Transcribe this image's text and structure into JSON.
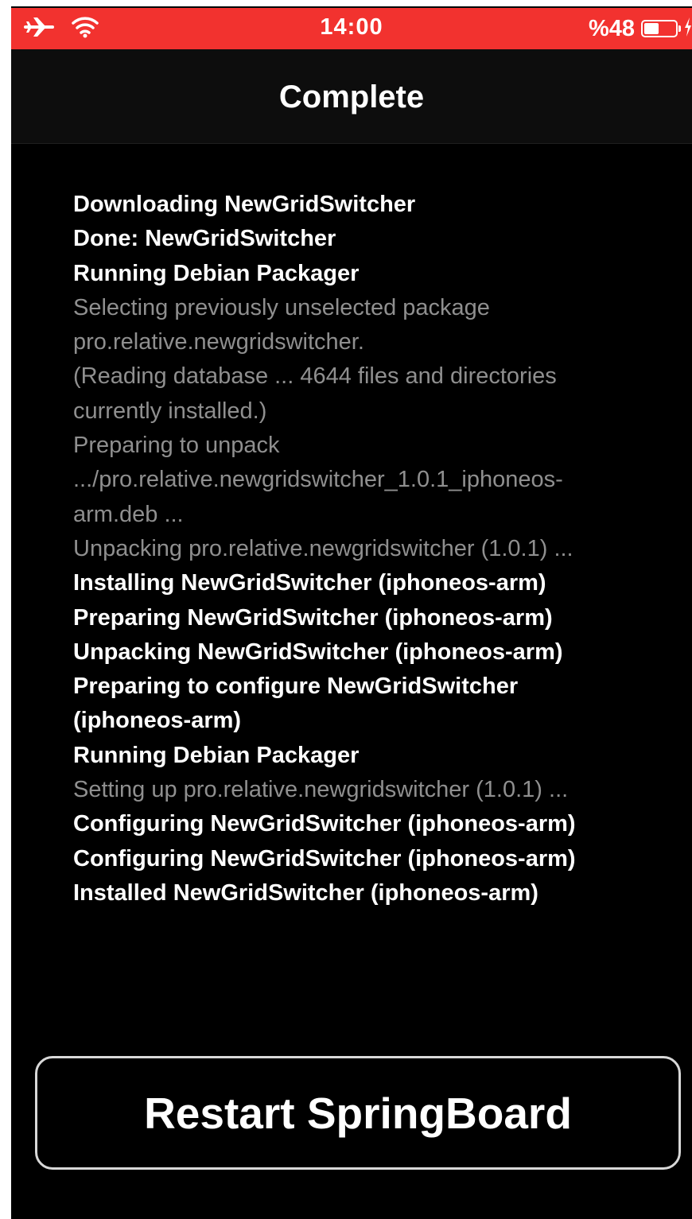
{
  "status_bar": {
    "time": "14:00",
    "battery_percent": "%48",
    "battery_level": 0.48,
    "background_color": "#f2322f",
    "icons": [
      "airplane-icon",
      "wifi-icon",
      "battery-icon",
      "charging-bolt-icon"
    ]
  },
  "nav": {
    "title": "Complete"
  },
  "log": {
    "lines": [
      {
        "text": "Downloading NewGridSwitcher",
        "style": "strong"
      },
      {
        "text": "Done: NewGridSwitcher",
        "style": "strong"
      },
      {
        "text": "Running Debian Packager",
        "style": "strong"
      },
      {
        "text": "Selecting previously unselected package",
        "style": "dim"
      },
      {
        "text": "pro.relative.newgridswitcher.",
        "style": "dim"
      },
      {
        "text": "(Reading database ... 4644 files and directories",
        "style": "dim"
      },
      {
        "text": "currently installed.)",
        "style": "dim"
      },
      {
        "text": "Preparing to unpack",
        "style": "dim"
      },
      {
        "text": ".../pro.relative.newgridswitcher_1.0.1_iphoneos-",
        "style": "dim"
      },
      {
        "text": "arm.deb ...",
        "style": "dim"
      },
      {
        "text": "Unpacking pro.relative.newgridswitcher (1.0.1) ...",
        "style": "dim"
      },
      {
        "text": "Installing NewGridSwitcher (iphoneos-arm)",
        "style": "strong"
      },
      {
        "text": "Preparing NewGridSwitcher (iphoneos-arm)",
        "style": "strong"
      },
      {
        "text": "Unpacking NewGridSwitcher (iphoneos-arm)",
        "style": "strong"
      },
      {
        "text": "Preparing to configure NewGridSwitcher",
        "style": "strong"
      },
      {
        "text": "(iphoneos-arm)",
        "style": "strong"
      },
      {
        "text": "Running Debian Packager",
        "style": "strong"
      },
      {
        "text": "Setting up pro.relative.newgridswitcher (1.0.1) ...",
        "style": "dim"
      },
      {
        "text": "Configuring NewGridSwitcher (iphoneos-arm)",
        "style": "strong"
      },
      {
        "text": "Configuring NewGridSwitcher (iphoneos-arm)",
        "style": "strong"
      },
      {
        "text": "Installed NewGridSwitcher (iphoneos-arm)",
        "style": "strong"
      }
    ]
  },
  "actions": {
    "restart_label": "Restart SpringBoard"
  }
}
